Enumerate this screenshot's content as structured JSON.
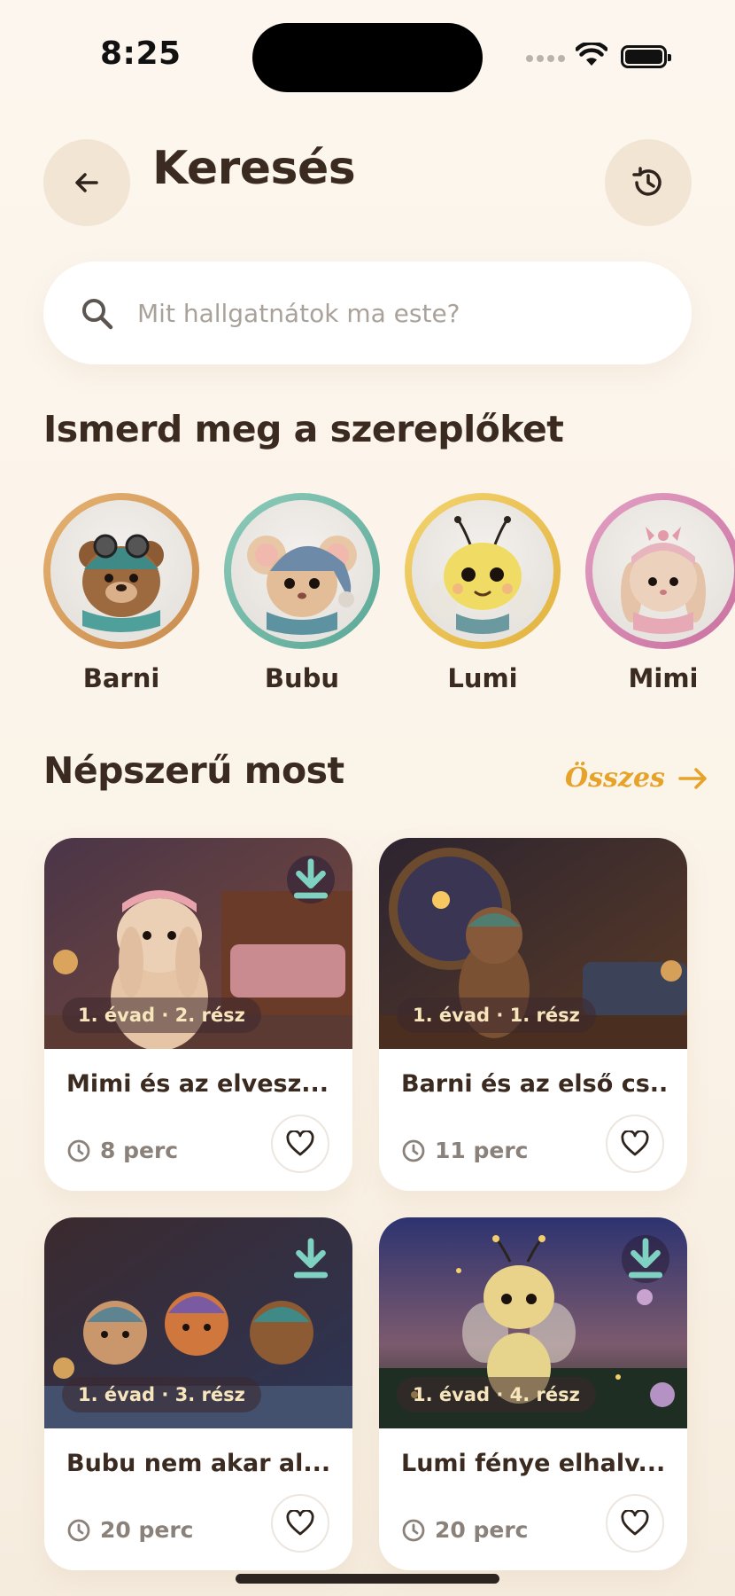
{
  "status_bar": {
    "time": "8:25"
  },
  "header": {
    "title": "Keresés"
  },
  "search": {
    "placeholder": "Mit hallgatnátok ma este?"
  },
  "characters_section": {
    "title": "Ismerd meg a szereplőket",
    "items": [
      {
        "name": "Barni",
        "ring_color": "#d9a262"
      },
      {
        "name": "Bubu",
        "ring_color": "#7fbfae"
      },
      {
        "name": "Lumi",
        "ring_color": "#eec65a"
      },
      {
        "name": "Mimi",
        "ring_color": "#d588b0"
      }
    ]
  },
  "popular_section": {
    "title": "Népszerű most",
    "see_all_label": "Összes",
    "cards": [
      {
        "episode": "1. évad · 2. rész",
        "title": "Mimi és az elvesz...",
        "duration": "8 perc"
      },
      {
        "episode": "1. évad · 1. rész",
        "title": "Barni és az első cs...",
        "duration": "11 perc"
      },
      {
        "episode": "1. évad · 3. rész",
        "title": "Bubu nem akar al...",
        "duration": "20 perc"
      },
      {
        "episode": "1. évad · 4. rész",
        "title": "Lumi fénye elhalv...",
        "duration": "20 perc"
      }
    ]
  },
  "colors": {
    "background": "#fbf4ea",
    "accent": "#e6a229",
    "text": "#3a2a1f",
    "muted": "#8a817a"
  }
}
